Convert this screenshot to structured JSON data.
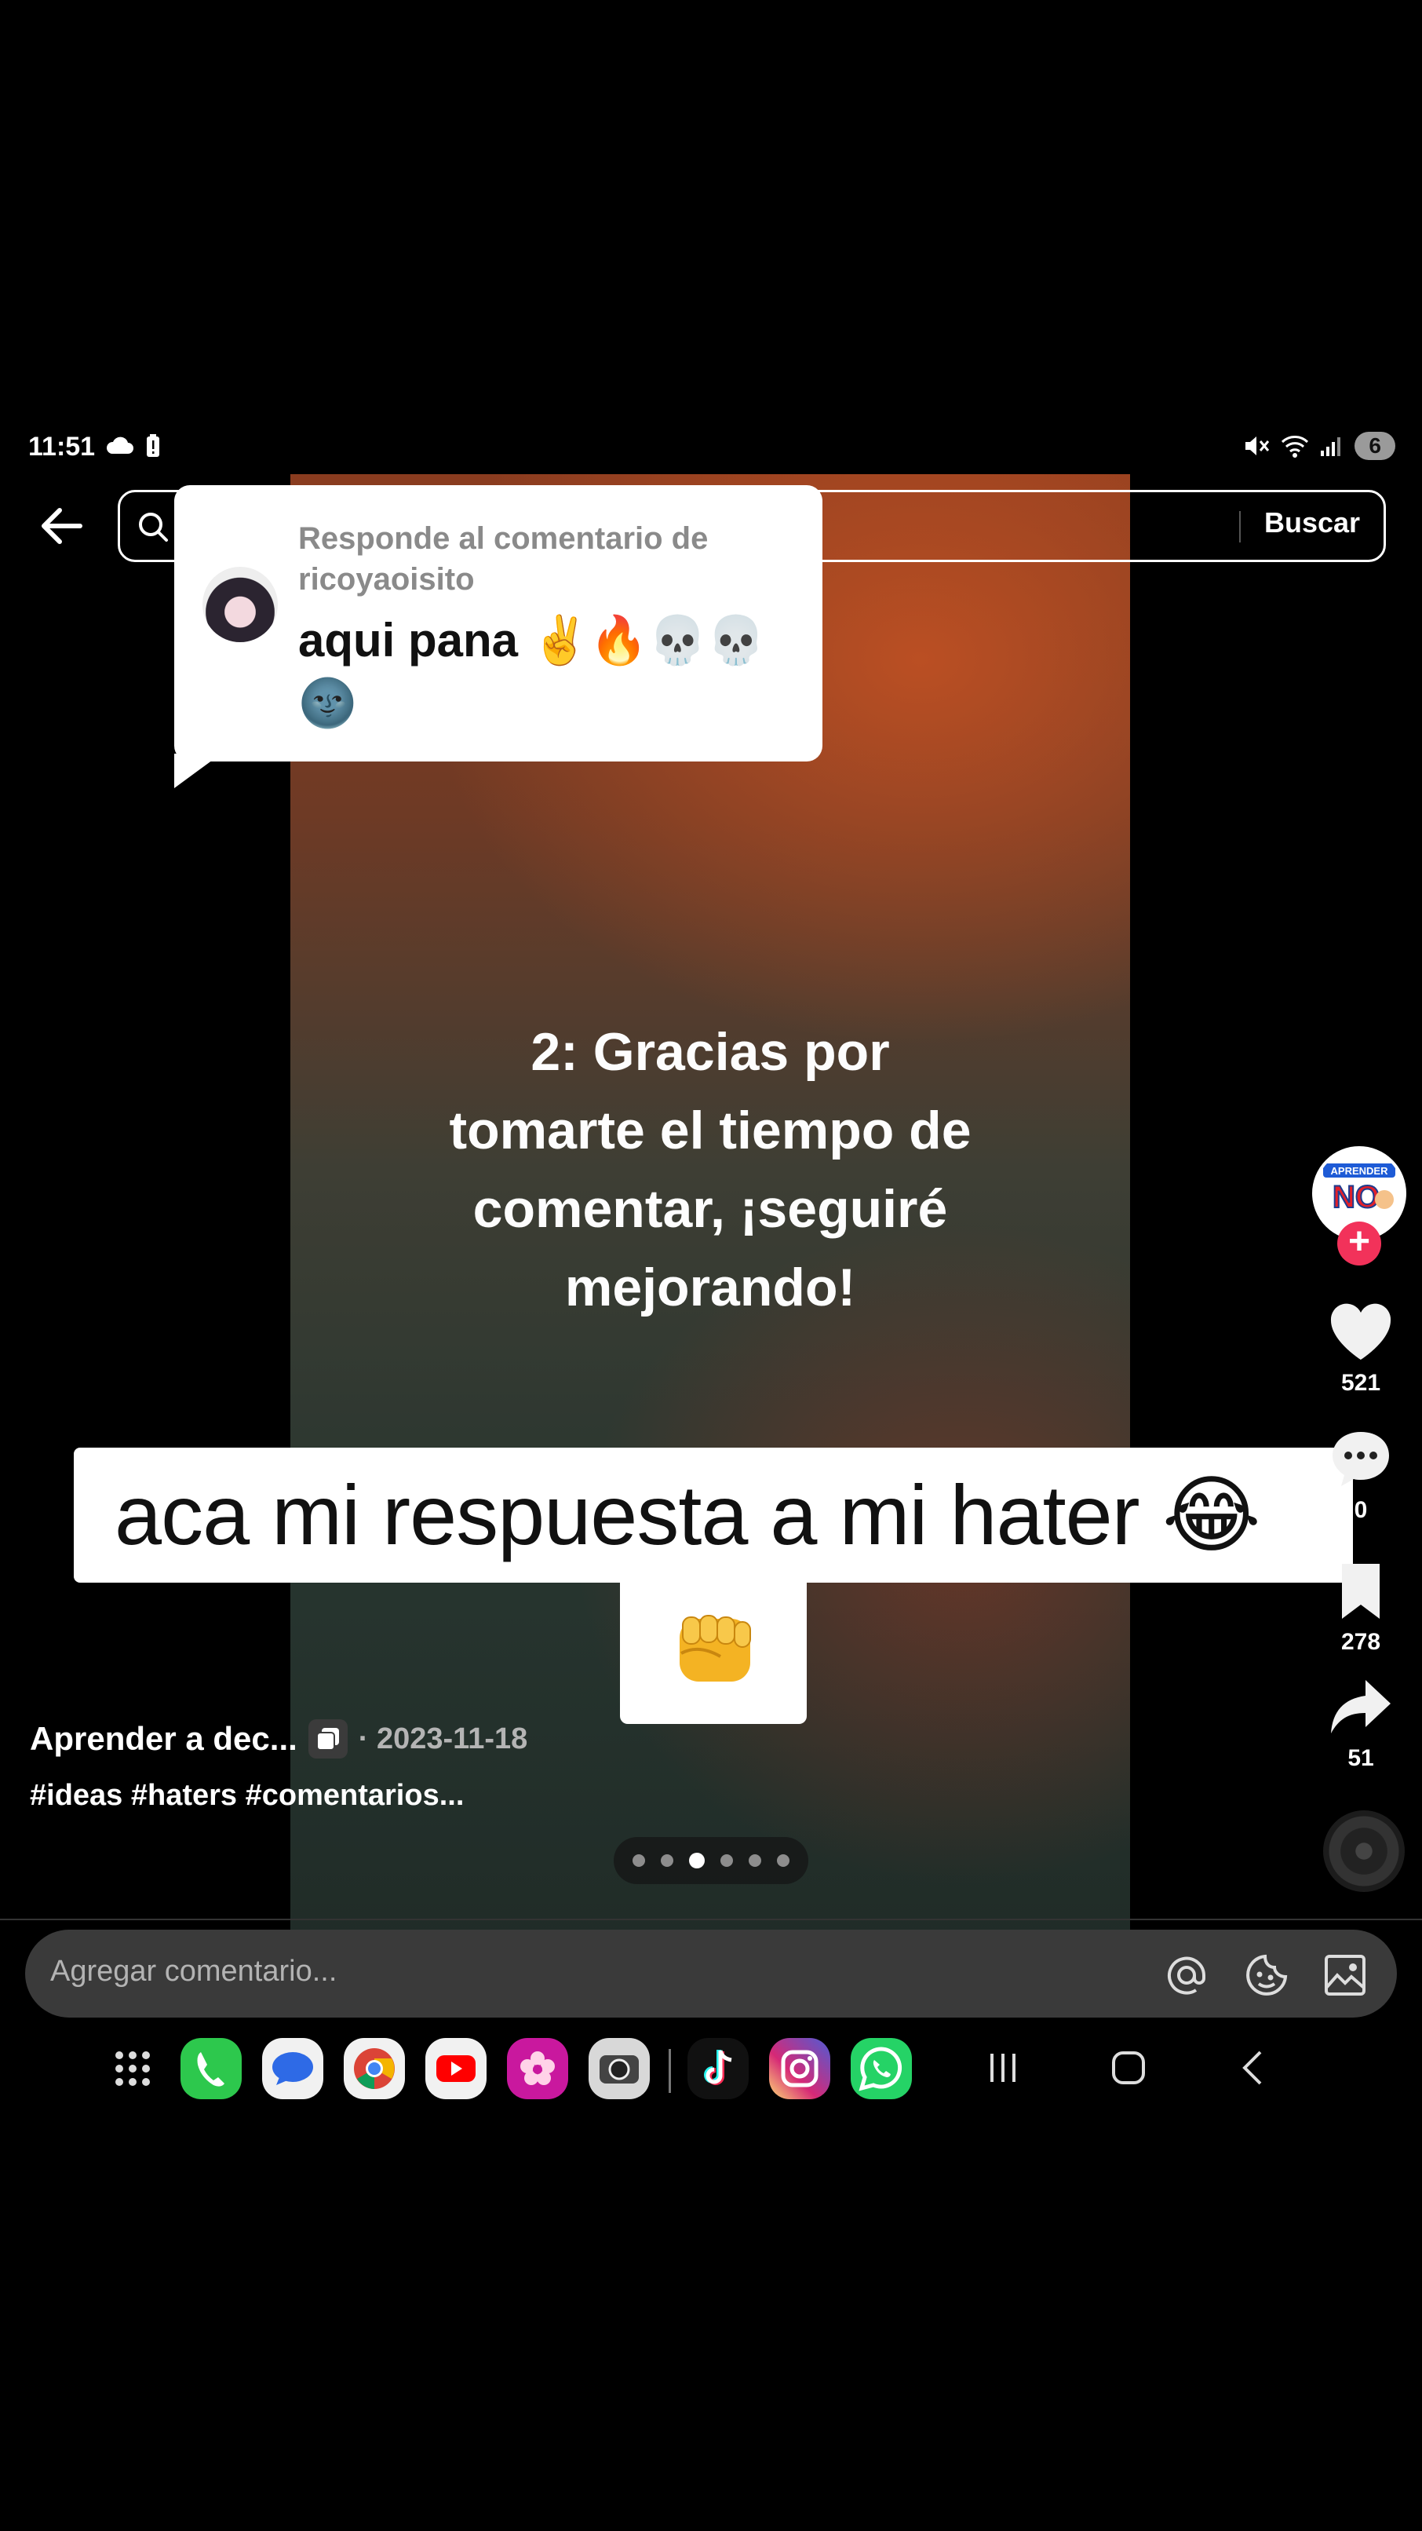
{
  "status_bar": {
    "time": "11:51",
    "battery_level": "6"
  },
  "header": {
    "search_button": "Buscar"
  },
  "reply_bubble": {
    "label": "Responde al comentario de ricoyaoisito",
    "comment_text": "aqui pana ✌️🔥💀💀🌚"
  },
  "video": {
    "overlay_text": "2: Gracias por tomarte el tiempo de comentar, ¡seguiré mejorando!",
    "caption_banner": "aca mi respuesta a mi hater 😂",
    "sticker_emoji": "👊"
  },
  "rail": {
    "likes": "521",
    "comments": "0",
    "saves": "278",
    "shares": "51"
  },
  "post": {
    "author": "Aprender a dec...",
    "date": "· 2023-11-18",
    "hashtags": "#ideas #haters #comentarios..."
  },
  "carousel": {
    "total": 6,
    "active_index": 2
  },
  "comment_bar": {
    "placeholder": "Agregar comentario..."
  },
  "colors": {
    "accent_red": "#f2325a",
    "background": "#000000"
  },
  "dock_apps": [
    "apps-grid",
    "phone",
    "messages",
    "chrome",
    "youtube",
    "gallery",
    "camera",
    "tiktok",
    "instagram",
    "whatsapp"
  ]
}
